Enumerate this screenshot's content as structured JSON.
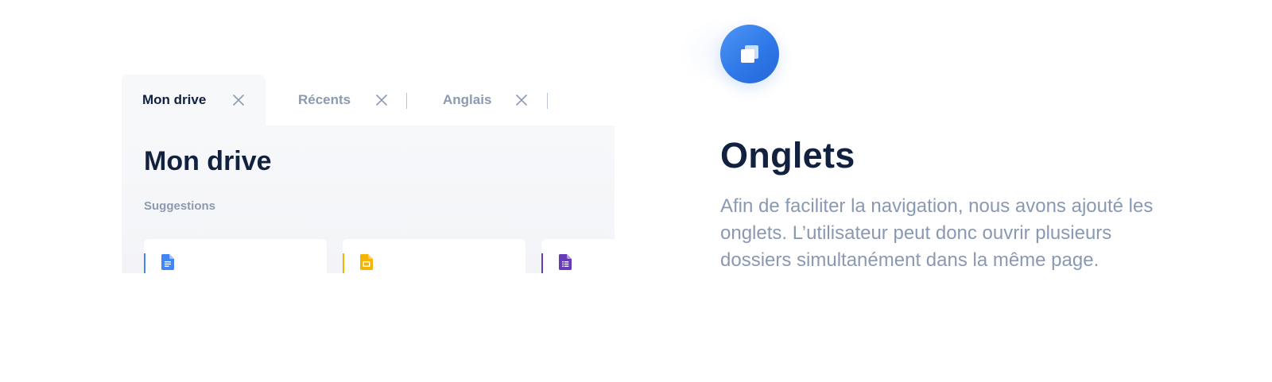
{
  "tabs": [
    {
      "label": "Mon drive",
      "active": true
    },
    {
      "label": "Récents",
      "active": false
    },
    {
      "label": "Anglais",
      "active": false
    }
  ],
  "main": {
    "title": "Mon drive",
    "section_label": "Suggestions",
    "cards": [
      {
        "icon": "google-docs-icon",
        "accent": "#4285f4"
      },
      {
        "icon": "google-slides-icon",
        "accent": "#f4b400"
      },
      {
        "icon": "google-forms-icon",
        "accent": "#673ab7"
      }
    ]
  },
  "feature": {
    "icon": "tabs-icon",
    "title": "Onglets",
    "description": "Afin de faciliter la navigation, nous avons ajouté les onglets. L’utilisateur peut donc ouvrir plusieurs dossiers simultanément dans la même page."
  },
  "colors": {
    "heading": "#12213f",
    "muted": "#8c9ab0",
    "accent_blue": "#2f78e8"
  }
}
